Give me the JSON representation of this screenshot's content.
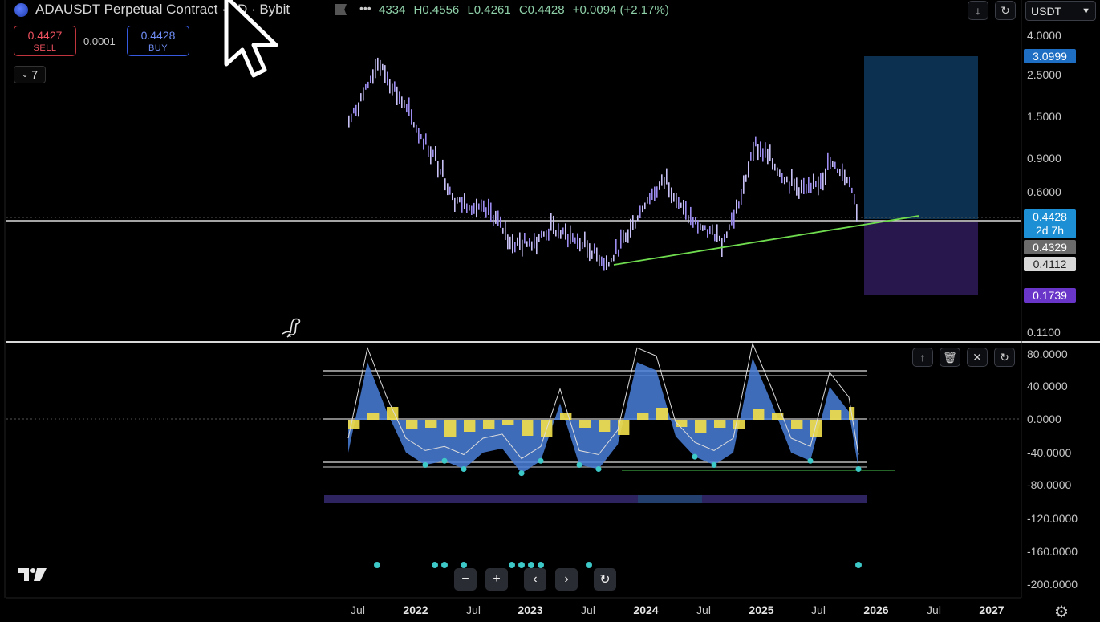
{
  "header": {
    "symbol_title": "ADAUSDT Perpetual Contract · 4D · Bybit",
    "ohlc": {
      "o": "4334",
      "h": "H0.4556",
      "l": "L0.4261",
      "c": "C0.4428",
      "change": "+0.0094 (+2.17%)"
    },
    "more_label": "•••",
    "currency": "USDT"
  },
  "trade": {
    "sell_price": "0.4427",
    "sell_label": "SELL",
    "spread": "0.0001",
    "buy_price": "0.4428",
    "buy_label": "BUY",
    "layer_count": "7"
  },
  "price_scale": {
    "labels": [
      "4.0000",
      "2.5000",
      "1.5000",
      "0.9000",
      "0.6000",
      "0.1100"
    ],
    "badges": {
      "target": "3.0999",
      "current": "0.4428",
      "countdown": "2d 7h",
      "entry": "0.4329",
      "level": "0.4112",
      "stop": "0.1739"
    }
  },
  "oscillator_scale": {
    "labels": [
      "80.0000",
      "40.0000",
      "0.0000",
      "-40.0000",
      "-80.0000",
      "-120.0000",
      "-160.0000",
      "-200.0000"
    ]
  },
  "time_axis": {
    "labels": [
      {
        "text": "Jul",
        "year": false
      },
      {
        "text": "2022",
        "year": true
      },
      {
        "text": "Jul",
        "year": false
      },
      {
        "text": "2023",
        "year": true
      },
      {
        "text": "Jul",
        "year": false
      },
      {
        "text": "2024",
        "year": true
      },
      {
        "text": "Jul",
        "year": false
      },
      {
        "text": "2025",
        "year": true
      },
      {
        "text": "Jul",
        "year": false
      },
      {
        "text": "2026",
        "year": true
      },
      {
        "text": "Jul",
        "year": false
      },
      {
        "text": "2027",
        "year": true
      }
    ]
  },
  "chart_data": {
    "type": "line",
    "price_series": {
      "x": [
        "2021-06",
        "2021-08",
        "2021-09",
        "2021-11",
        "2022-01",
        "2022-03",
        "2022-05",
        "2022-07",
        "2022-09",
        "2022-11",
        "2023-01",
        "2023-03",
        "2023-05",
        "2023-07",
        "2023-09",
        "2023-11",
        "2024-01",
        "2024-03",
        "2024-05",
        "2024-07",
        "2024-09",
        "2024-11",
        "2024-12",
        "2025-02",
        "2025-04",
        "2025-06",
        "2025-08",
        "2025-10",
        "2025-11"
      ],
      "y": [
        1.4,
        2.2,
        2.9,
        2.0,
        1.3,
        0.9,
        0.55,
        0.5,
        0.45,
        0.32,
        0.33,
        0.38,
        0.35,
        0.3,
        0.25,
        0.36,
        0.55,
        0.7,
        0.45,
        0.38,
        0.34,
        0.6,
        1.1,
        0.85,
        0.65,
        0.6,
        0.85,
        0.7,
        0.4428
      ]
    },
    "oscillator_series": {
      "x": [
        "2021-06",
        "2021-08",
        "2021-10",
        "2021-12",
        "2022-02",
        "2022-04",
        "2022-06",
        "2022-08",
        "2022-10",
        "2022-12",
        "2023-02",
        "2023-04",
        "2023-06",
        "2023-08",
        "2023-10",
        "2023-12",
        "2024-02",
        "2024-04",
        "2024-06",
        "2024-08",
        "2024-10",
        "2024-12",
        "2025-02",
        "2025-04",
        "2025-06",
        "2025-08",
        "2025-10",
        "2025-11"
      ],
      "y": [
        -40,
        70,
        10,
        -40,
        -55,
        -50,
        -60,
        -40,
        -35,
        -65,
        -50,
        20,
        -55,
        -60,
        -30,
        70,
        60,
        -20,
        -45,
        -55,
        -40,
        75,
        20,
        -40,
        -50,
        40,
        10,
        -60
      ]
    },
    "trendline": "support from 2023-09 low to 2025-11",
    "position": {
      "entry": 0.4428,
      "target": 3.0999,
      "stop": 0.1739
    },
    "price_scale": "log",
    "colors": {
      "candles": "#9b8df0",
      "target_zone": "#0e3a5e",
      "stop_zone": "#2b1a55",
      "trendline": "#6fdb4e",
      "osc_fill": "#4a7fd8",
      "osc_yellow": "#f3e04a"
    }
  }
}
